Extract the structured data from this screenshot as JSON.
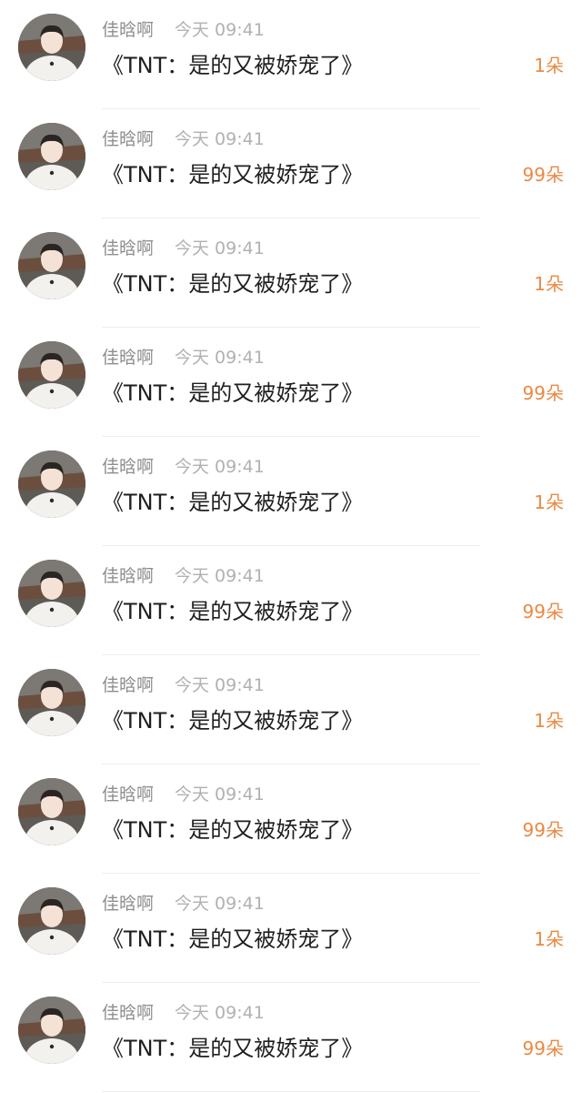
{
  "comments": [
    {
      "username": "佳晗啊",
      "time": "今天 09:41",
      "text": "《TNT：是的又被娇宠了》",
      "gift": "1朵"
    },
    {
      "username": "佳晗啊",
      "time": "今天 09:41",
      "text": "《TNT：是的又被娇宠了》",
      "gift": "99朵"
    },
    {
      "username": "佳晗啊",
      "time": "今天 09:41",
      "text": "《TNT：是的又被娇宠了》",
      "gift": "1朵"
    },
    {
      "username": "佳晗啊",
      "time": "今天 09:41",
      "text": "《TNT：是的又被娇宠了》",
      "gift": "99朵"
    },
    {
      "username": "佳晗啊",
      "time": "今天 09:41",
      "text": "《TNT：是的又被娇宠了》",
      "gift": "1朵"
    },
    {
      "username": "佳晗啊",
      "time": "今天 09:41",
      "text": "《TNT：是的又被娇宠了》",
      "gift": "99朵"
    },
    {
      "username": "佳晗啊",
      "time": "今天 09:41",
      "text": "《TNT：是的又被娇宠了》",
      "gift": "1朵"
    },
    {
      "username": "佳晗啊",
      "time": "今天 09:41",
      "text": "《TNT：是的又被娇宠了》",
      "gift": "99朵"
    },
    {
      "username": "佳晗啊",
      "time": "今天 09:41",
      "text": "《TNT：是的又被娇宠了》",
      "gift": "1朵"
    },
    {
      "username": "佳晗啊",
      "time": "今天 09:41",
      "text": "《TNT：是的又被娇宠了》",
      "gift": "99朵"
    }
  ],
  "colors": {
    "gift": "#e98a43",
    "username": "#8e8e8e",
    "time": "#b1b1b1",
    "text": "#1f1f1f"
  },
  "icons": {
    "avatar": "user-avatar-photo"
  }
}
